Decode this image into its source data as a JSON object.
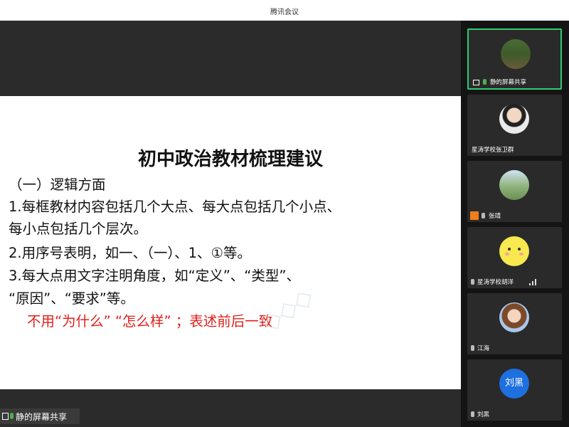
{
  "window": {
    "title": "腾讯会议"
  },
  "slide": {
    "title": "初中政治教材梳理建议",
    "lines": [
      "（一）逻辑方面",
      "1.每框教材内容包括几个大点、每大点包括几个小点、",
      "每小点包括几个层次。",
      "2.用序号表明，如一、（一）、1、①等。",
      "3.每大点用文字注明角度，如“定义”、“类型”、",
      "“原因”、“要求”等。"
    ],
    "highlight": "不用“为什么”  “怎么样”  ；表述前后一致"
  },
  "share_bar": {
    "label": "静的屏幕共享"
  },
  "participants": [
    {
      "name": "静的屏幕共享",
      "avatar_icon": "landscape-photo-avatar",
      "active": true
    },
    {
      "name": "星涛学校张卫群",
      "avatar_icon": "person-photo-avatar"
    },
    {
      "name": "张靖",
      "avatar_icon": "outdoor-photo-avatar",
      "host": true
    },
    {
      "name": "星涛学校胡洋",
      "avatar_icon": "smiley-avatar"
    },
    {
      "name": "江海",
      "avatar_icon": "cartoon-girl-avatar"
    },
    {
      "name": "刘黑",
      "avatar_icon": "text-avatar",
      "avatar_text": "刘黑"
    }
  ],
  "colors": {
    "accent": "#2ecc71",
    "highlight_text": "#e0201b",
    "host_badge": "#f07d1a"
  }
}
